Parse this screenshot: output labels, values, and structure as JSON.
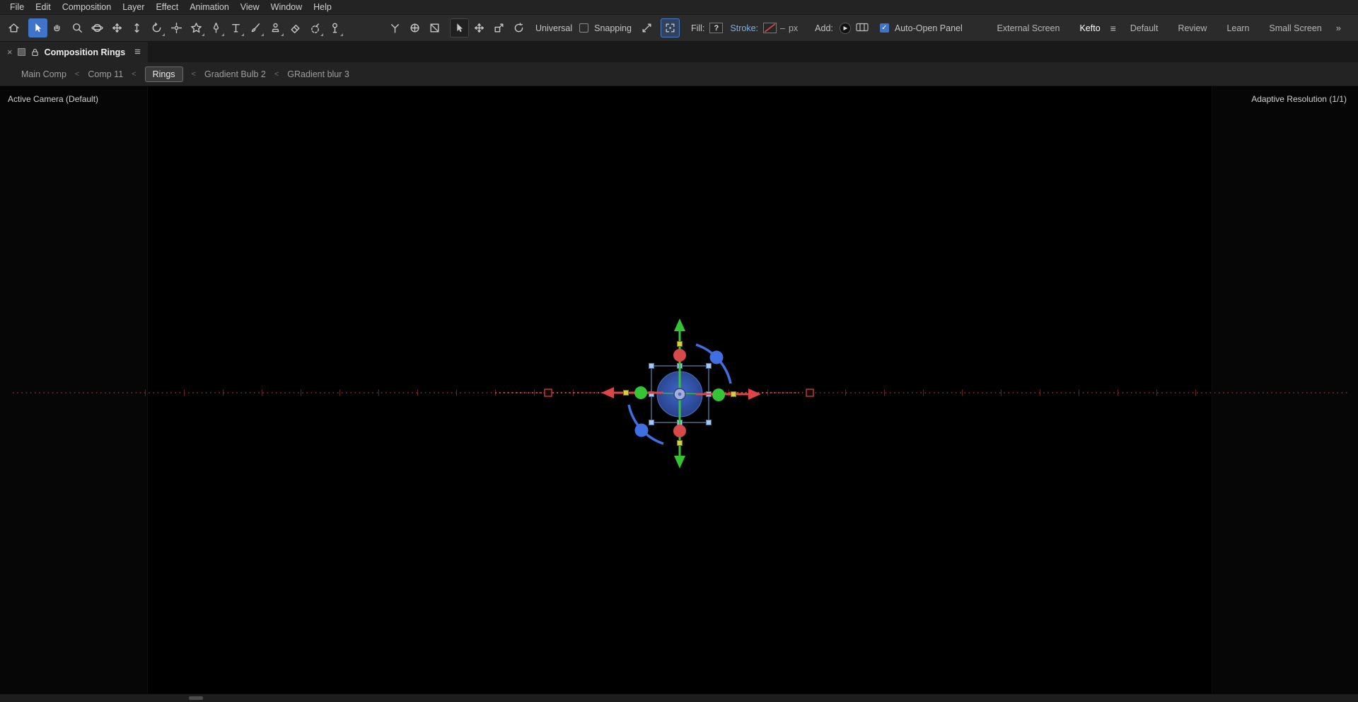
{
  "menu_bar": {
    "items": [
      "File",
      "Edit",
      "Composition",
      "Layer",
      "Effect",
      "Animation",
      "View",
      "Window",
      "Help"
    ]
  },
  "toolbar": {
    "tool_icons": [
      "home",
      "selection",
      "hand",
      "zoom",
      "orbit-camera",
      "pan-camera",
      "dolly-camera",
      "rotation",
      "pan-behind",
      "shape",
      "pen",
      "type",
      "brush",
      "clone-stamp",
      "eraser",
      "roto-brush",
      "puppet-pin"
    ],
    "active_tool": "selection",
    "gizmo_icons": [
      "local-axis",
      "world-axis",
      "view-axis",
      "gizmo-select",
      "gizmo-position",
      "gizmo-scale",
      "gizmo-rotation",
      "snap-extents",
      "snap-bounds"
    ],
    "labels": {
      "mode": "Universal",
      "snapping": "Snapping",
      "fill": "Fill:",
      "fill_value": "?",
      "stroke": "Stroke:",
      "stroke_width": "–",
      "stroke_unit": "px",
      "add": "Add:",
      "auto_open": "Auto-Open Panel"
    },
    "workspaces": [
      {
        "label": "External Screen",
        "active": false
      },
      {
        "label": "Kefto",
        "active": true
      },
      {
        "label": "Default",
        "active": false
      },
      {
        "label": "Review",
        "active": false
      },
      {
        "label": "Learn",
        "active": false
      },
      {
        "label": "Small Screen",
        "active": false
      }
    ]
  },
  "panel": {
    "title": "Composition Rings"
  },
  "breadcrumb": {
    "separator": "<",
    "items": [
      "Main Comp",
      "Comp 11",
      "Rings",
      "Gradient Bulb 2",
      "GRadient blur 3"
    ],
    "active_item": "Rings"
  },
  "viewer": {
    "camera_label": "Active Camera (Default)",
    "resolution_label": "Adaptive Resolution (1/1)"
  },
  "icons": {
    "check": "✓",
    "menu": "≡",
    "close": "×",
    "overflow": "»",
    "play": "▶"
  },
  "colors": {
    "accent_blue": "#3f74c9",
    "axis_red": "#e04545",
    "axis_green": "#35c435",
    "axis_blue": "#3f6fe0",
    "handle_blue": "#aac6ec",
    "scale_yellow": "#d8cf3f",
    "path_red": "#8f2f2f",
    "layer_blue": "#2b4fa0"
  }
}
